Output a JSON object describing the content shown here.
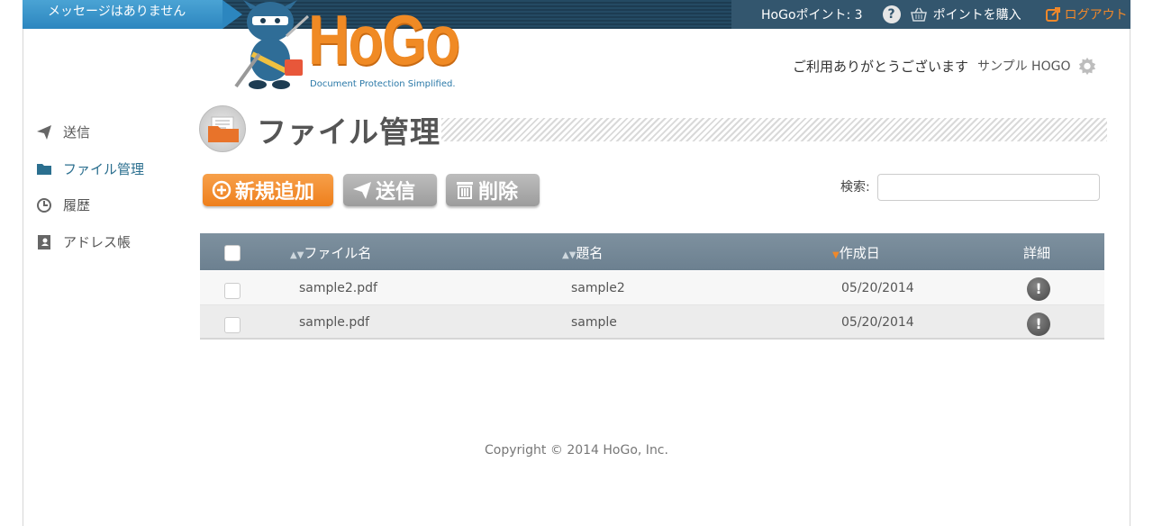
{
  "topbar": {
    "message": "メッセージはありません",
    "points": "HoGoポイント: 3",
    "buy_points": "ポイントを購入",
    "logout": "ログアウト"
  },
  "logo": {
    "word": "HoGo",
    "tagline": "Document Protection Simplified."
  },
  "header": {
    "greeting": "ご利用ありがとうございます",
    "user": "サンプル HOGO"
  },
  "sidebar": {
    "items": [
      {
        "label": "送信",
        "icon": "paper-plane-icon"
      },
      {
        "label": "ファイル管理",
        "icon": "folder-icon",
        "active": true
      },
      {
        "label": "履歴",
        "icon": "clock-icon"
      },
      {
        "label": "アドレス帳",
        "icon": "address-book-icon"
      }
    ]
  },
  "page": {
    "title": "ファイル管理"
  },
  "toolbar": {
    "add_label": "新規追加",
    "send_label": "送信",
    "delete_label": "削除",
    "search_label": "検索:",
    "search_value": ""
  },
  "table": {
    "columns": [
      "ファイル名",
      "題名",
      "作成日",
      "詳細"
    ],
    "rows": [
      {
        "filename": "sample2.pdf",
        "subject": "sample2",
        "created": "05/20/2014"
      },
      {
        "filename": "sample.pdf",
        "subject": "sample",
        "created": "05/20/2014"
      }
    ]
  },
  "footer": {
    "copyright": "Copyright © 2014 HoGo, Inc."
  },
  "colors": {
    "accent": "#f08a24",
    "nav_active": "#2b6f8f",
    "table_header": "#74889a"
  }
}
